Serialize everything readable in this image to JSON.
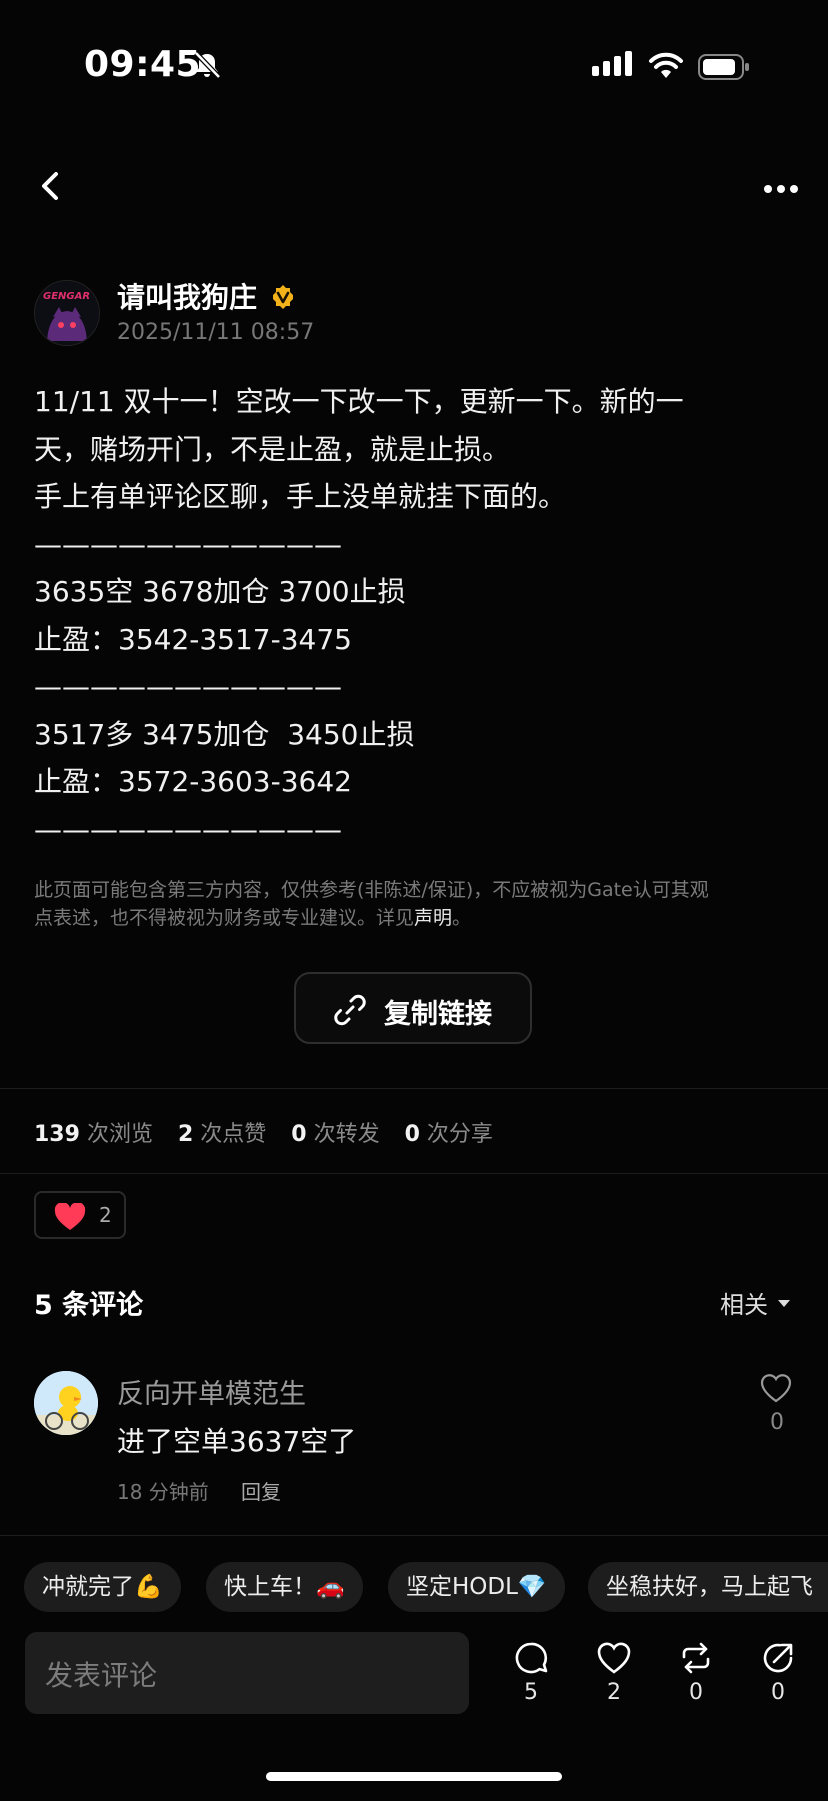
{
  "status_bar": {
    "time": "09:45"
  },
  "author": {
    "name": "请叫我狗庄",
    "date": "2025/11/11 08:57",
    "avatar_text": "GENGAR"
  },
  "post": {
    "lines": [
      "11/11 双十一！空改一下改一下，更新一下。新的一",
      "天，赌场开门，不是止盈，就是止损。",
      "手上有单评论区聊，手上没单就挂下面的。",
      "———————————",
      "3635空 3678加仓 3700止损",
      "止盈：3542-3517-3475",
      "———————————",
      "3517多 3475加仓  3450止损",
      "止盈：3572-3603-3642",
      "———————————"
    ],
    "disclaimer_line1": "此页面可能包含第三方内容，仅供参考(非陈述/保证)，不应被视为Gate认可其观",
    "disclaimer_line2": "点表述，也不得被视为财务或专业建议。详见",
    "disclaimer_link": "声明",
    "disclaimer_end": "。",
    "copy_link_label": "复制链接"
  },
  "stats": {
    "views": "139",
    "views_label": "次浏览",
    "likes": "2",
    "likes_label": "次点赞",
    "reposts": "0",
    "reposts_label": "次转发",
    "shares": "0",
    "shares_label": "次分享"
  },
  "like_chip": {
    "count": "2"
  },
  "comments": {
    "title": "5 条评论",
    "sort_label": "相关",
    "items": [
      {
        "user": "反向开单模范生",
        "text": "进了空单3637空了",
        "time": "18 分钟前",
        "reply_label": "回复",
        "likes": "0"
      }
    ]
  },
  "quick_replies": [
    "冲就完了💪",
    "快上车！🚗",
    "坚定HODL💎",
    "坐稳扶好，马上起飞"
  ],
  "bottom_bar": {
    "placeholder": "发表评论",
    "comment_count": "5",
    "like_count": "2",
    "repost_count": "0",
    "share_count": "0"
  },
  "colors": {
    "background": "#050505",
    "heart": "#ff3b57",
    "verified": "#f3b21a"
  }
}
